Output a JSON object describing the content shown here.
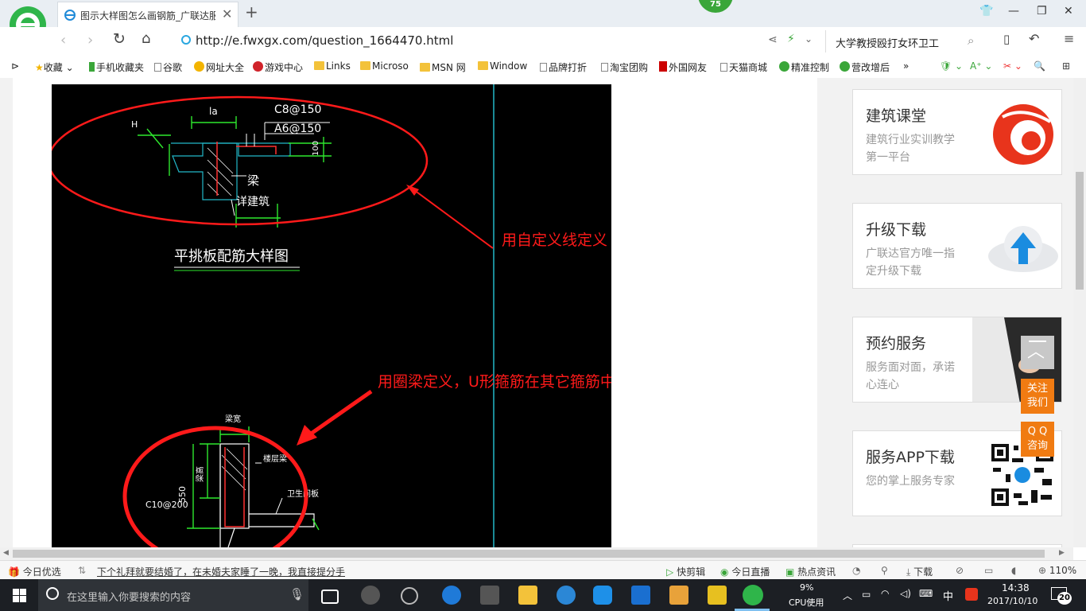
{
  "browser": {
    "tab_title": "图示大样图怎么画钢筋_广联达服",
    "badge": "75",
    "url": "http://e.fwxgx.com/question_1664470.html",
    "search_text": "大学教授殴打女环卫工"
  },
  "bookmarks": [
    {
      "label": "收藏"
    },
    {
      "label": "手机收藏夹"
    },
    {
      "label": "谷歌"
    },
    {
      "label": "网址大全"
    },
    {
      "label": "游戏中心"
    },
    {
      "label": "Links"
    },
    {
      "label": "Microso"
    },
    {
      "label": "MSN 网"
    },
    {
      "label": "Window"
    },
    {
      "label": "品牌打折"
    },
    {
      "label": "淘宝团购"
    },
    {
      "label": "外国网友"
    },
    {
      "label": "天猫商城"
    },
    {
      "label": "精准控制"
    },
    {
      "label": "营改增后"
    }
  ],
  "drawing": {
    "top_labels": {
      "c8": "C8@150",
      "a6": "A6@150",
      "la": "la",
      "h": "H",
      "dim100": "100",
      "beam": "梁",
      "detail": "详建筑"
    },
    "caption": "平挑板配筋大样图",
    "annotation1": "用自定义线定义",
    "annotation2": "用圈梁定义，U形箍筋在其它箍筋中输入",
    "bottom_labels": {
      "width": "梁宽",
      "height": "梁高",
      "dim550": "550",
      "rebar": "C10@200",
      "floor_beam": "楼层梁",
      "slab": "卫生间板"
    }
  },
  "sidebar": {
    "cards": [
      {
        "title": "建筑课堂",
        "desc": "建筑行业实训教学第一平台"
      },
      {
        "title": "升级下载",
        "desc": "广联达官方唯一指定升级下载"
      },
      {
        "title": "预约服务",
        "desc": "服务面对面，承诺心连心"
      },
      {
        "title": "服务APP下载",
        "desc": "您的掌上服务专家"
      }
    ],
    "follow_btn": [
      "关注",
      "我们"
    ],
    "qq_btn": [
      "Q Q",
      "咨询"
    ]
  },
  "statusbar": {
    "today": "今日优选",
    "news": "下个礼拜就要结婚了，在未婚夫家睡了一晚，我直接提分手",
    "quickcut": "快剪辑",
    "live": "今日直播",
    "hotnews": "热点资讯",
    "download": "下载",
    "zoom": "110%"
  },
  "taskbar": {
    "search_placeholder": "在这里输入你要搜索的内容",
    "cpu_pct": "9%",
    "cpu_label": "CPU使用",
    "ime": "中",
    "time": "14:38",
    "date": "2017/10/10",
    "notif_count": "20"
  },
  "colors": {
    "accent_green": "#3aa639",
    "annotation_red": "#ff1a1a",
    "cad_bg": "#000000",
    "orange": "#f07b12"
  }
}
